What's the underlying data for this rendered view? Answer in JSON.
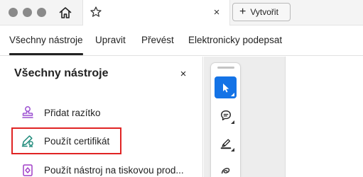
{
  "tabbar": {
    "create_label": "Vytvořit",
    "close_glyph": "×",
    "plus_glyph": "+"
  },
  "menu": {
    "items": [
      {
        "label": "Všechny nástroje",
        "active": true
      },
      {
        "label": "Upravit"
      },
      {
        "label": "Převést"
      },
      {
        "label": "Elektronicky podepsat"
      }
    ]
  },
  "panel": {
    "title": "Všechny nástroje",
    "close_glyph": "×",
    "tools": [
      {
        "label": "Přidat razítko",
        "icon": "stamp-icon",
        "color": "#9b4fd1"
      },
      {
        "label": "Použít certifikát",
        "icon": "certificate-pen-icon",
        "color": "#1e8a7a",
        "highlighted": true
      },
      {
        "label": "Použít nástroj na tiskovou prod...",
        "icon": "print-production-icon",
        "color": "#a13fc7"
      }
    ]
  },
  "quick_tools": [
    {
      "icon": "select-cursor-icon",
      "selected": true
    },
    {
      "icon": "comment-icon"
    },
    {
      "icon": "highlight-pen-icon"
    },
    {
      "icon": "draw-freehand-icon"
    }
  ],
  "colors": {
    "accent": "#1473e6",
    "highlight_border": "#e02424"
  }
}
